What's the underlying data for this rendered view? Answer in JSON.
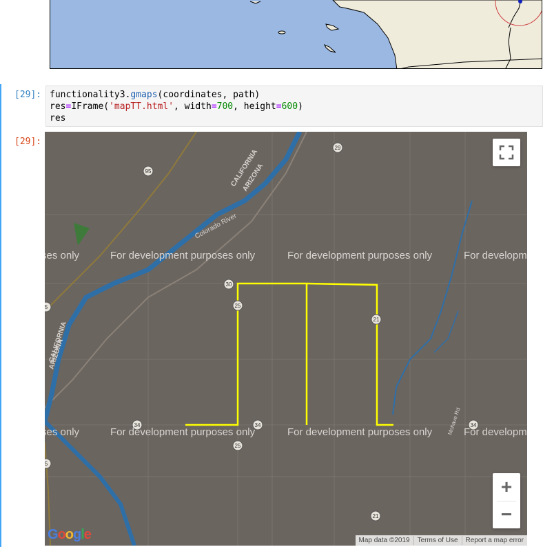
{
  "cells": [
    {
      "prompt": "[29]:",
      "code_lines": [
        [
          "functionality3.",
          "gmaps",
          "(coordinates, path)"
        ],
        [
          "res",
          "=",
          "IFrame(",
          "'mapTT.html'",
          ", width",
          "=",
          "700",
          ", height",
          "=",
          "600",
          ")"
        ],
        [
          "res"
        ]
      ]
    }
  ],
  "output": {
    "prompt": "[29]:",
    "map": {
      "watermark": "For development purposes only",
      "watermark_partial_left": "ses only",
      "watermark_partial_right": "For developm",
      "route_color": "#ffff00",
      "road_labels": [
        "95",
        "29",
        "30",
        "25",
        "21",
        "34",
        "34",
        "25",
        "34",
        "21",
        "5",
        "5"
      ],
      "place_labels": [
        "CALIFORNIA",
        "ARIZONA",
        "Colorado River",
        "CALIFORNIA",
        "ARIZONA",
        "Mohave Rd"
      ],
      "controls": {
        "fullscreen": "fullscreen-icon",
        "zoom_in": "+",
        "zoom_out": "−"
      },
      "logo": "Google",
      "attribution": [
        "Map data ©2019",
        "Terms of Use",
        "Report a map error"
      ]
    }
  }
}
